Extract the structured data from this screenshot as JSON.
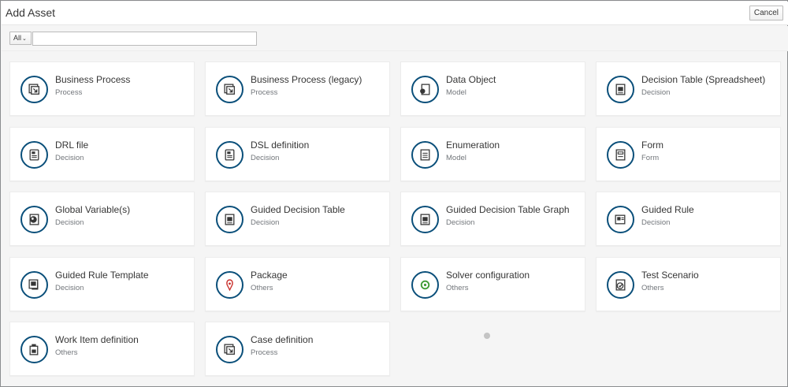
{
  "header": {
    "title": "Add Asset",
    "cancel_label": "Cancel"
  },
  "toolbar": {
    "filter_label": "All",
    "search_placeholder": "",
    "search_value": ""
  },
  "assets": [
    {
      "name": "Business Process",
      "category": "Process",
      "icon": "process-icon"
    },
    {
      "name": "Business Process (legacy)",
      "category": "Process",
      "icon": "process-icon"
    },
    {
      "name": "Data Object",
      "category": "Model",
      "icon": "data-object-icon"
    },
    {
      "name": "Decision Table (Spreadsheet)",
      "category": "Decision",
      "icon": "table-icon"
    },
    {
      "name": "DRL file",
      "category": "Decision",
      "icon": "document-icon"
    },
    {
      "name": "DSL definition",
      "category": "Decision",
      "icon": "document-icon"
    },
    {
      "name": "Enumeration",
      "category": "Model",
      "icon": "list-icon"
    },
    {
      "name": "Form",
      "category": "Form",
      "icon": "form-icon"
    },
    {
      "name": "Global Variable(s)",
      "category": "Decision",
      "icon": "globe-icon"
    },
    {
      "name": "Guided Decision Table",
      "category": "Decision",
      "icon": "table-icon"
    },
    {
      "name": "Guided Decision Table Graph",
      "category": "Decision",
      "icon": "table-icon"
    },
    {
      "name": "Guided Rule",
      "category": "Decision",
      "icon": "rule-icon"
    },
    {
      "name": "Guided Rule Template",
      "category": "Decision",
      "icon": "rule-template-icon"
    },
    {
      "name": "Package",
      "category": "Others",
      "icon": "package-icon"
    },
    {
      "name": "Solver configuration",
      "category": "Others",
      "icon": "solver-icon"
    },
    {
      "name": "Test Scenario",
      "category": "Others",
      "icon": "test-scenario-icon"
    },
    {
      "name": "Work Item definition",
      "category": "Others",
      "icon": "work-item-icon"
    },
    {
      "name": "Case definition",
      "category": "Process",
      "icon": "process-icon"
    }
  ],
  "colors": {
    "icon_ring": "#0a4f7a",
    "package_accent": "#c9302c",
    "solver_accent": "#3f9c35"
  }
}
